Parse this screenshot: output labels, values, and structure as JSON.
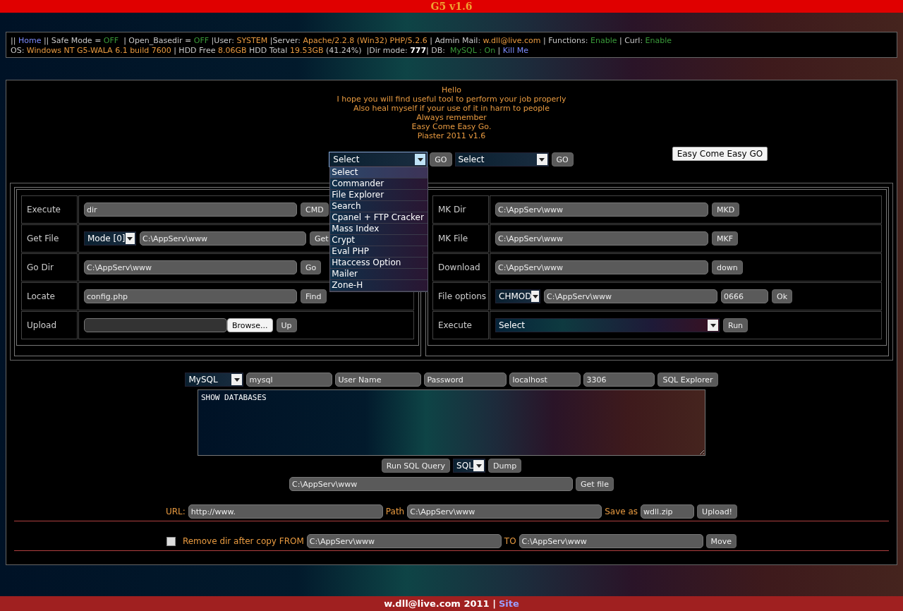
{
  "title": "G5 v1.6",
  "info_lines": [
    [
      {
        "kind": "plain",
        "text": "|| "
      },
      {
        "kind": "link",
        "text": "Home"
      },
      {
        "kind": "plain",
        "text": " || Safe Mode = "
      },
      {
        "kind": "on",
        "text": "OFF"
      },
      {
        "kind": "plain",
        "text": "  | Open_Basedir = "
      },
      {
        "kind": "on",
        "text": "OFF"
      },
      {
        "kind": "plain",
        "text": " |User: "
      },
      {
        "kind": "value",
        "text": "SYSTEM"
      },
      {
        "kind": "plain",
        "text": " |Server: "
      },
      {
        "kind": "value",
        "text": "Apache/2.2.8 (Win32) PHP/5.2.6"
      },
      {
        "kind": "plain",
        "text": " | Admin Mail: "
      },
      {
        "kind": "value",
        "text": "w.dll@live.com"
      },
      {
        "kind": "plain",
        "text": " | Functions: "
      },
      {
        "kind": "on",
        "text": "Enable"
      },
      {
        "kind": "plain",
        "text": " | Curl: "
      },
      {
        "kind": "on",
        "text": "Enable"
      }
    ],
    [
      {
        "kind": "plain",
        "text": "OS: "
      },
      {
        "kind": "value",
        "text": "Windows NT G5-WALA 6.1 build 7600"
      },
      {
        "kind": "plain",
        "text": " | HDD Free "
      },
      {
        "kind": "value",
        "text": "8.06GB"
      },
      {
        "kind": "plain",
        "text": " HDD Total "
      },
      {
        "kind": "value",
        "text": "19.53GB"
      },
      {
        "kind": "plain",
        "text": " (41.24%)  |Dir mode: "
      },
      {
        "kind": "bold",
        "text": "777"
      },
      {
        "kind": "plain",
        "text": "| DB:  "
      },
      {
        "kind": "on",
        "text": "MySQL : On"
      },
      {
        "kind": "plain",
        "text": " | "
      },
      {
        "kind": "link",
        "text": "Kill Me"
      }
    ]
  ],
  "greeting": [
    "Hello",
    "I hope you will find useful tool to perform your job properly",
    "Also heal myself if your use of it in harm to people",
    "Always remember",
    "Easy Come Easy Go.",
    "Piaster 2011 v1.6"
  ],
  "menu_selects": [
    {
      "value": "Select",
      "button": "GO",
      "expanded": true,
      "options": [
        {
          "label": "Select",
          "selected": true
        },
        {
          "label": "Commander",
          "selected": false
        },
        {
          "label": "File Explorer",
          "selected": false
        },
        {
          "label": "Search",
          "selected": false
        },
        {
          "label": "Cpanel + FTP Cracker",
          "selected": false
        },
        {
          "label": "Mass Index",
          "selected": false
        },
        {
          "label": "Crypt",
          "selected": false
        },
        {
          "label": "Eval PHP",
          "selected": false
        },
        {
          "label": "Htaccess Option",
          "selected": false
        },
        {
          "label": "Mailer",
          "selected": false
        },
        {
          "label": "Zone-H",
          "selected": false
        }
      ]
    },
    {
      "value": "Select",
      "button": "GO",
      "expanded": false
    }
  ],
  "motto_button": "Easy Come Easy GO",
  "left_tools": [
    {
      "kind": "input",
      "label": "Execute",
      "value": "dir",
      "button": "CMD"
    },
    {
      "kind": "mode",
      "label": "Get File",
      "select": "Mode [0]",
      "value": "C:\\AppServ\\www",
      "button": "Get"
    },
    {
      "kind": "input",
      "label": "Go Dir",
      "value": "C:\\AppServ\\www",
      "button": "Go"
    },
    {
      "kind": "input",
      "label": "Locate",
      "value": "config.php",
      "button": "Find"
    },
    {
      "kind": "upload",
      "label": "Upload",
      "browse": "Browse...",
      "button": "Up"
    }
  ],
  "right_tools": [
    {
      "kind": "input",
      "label": "MK Dir",
      "value": "C:\\AppServ\\www",
      "button": "MKD"
    },
    {
      "kind": "input",
      "label": "MK File",
      "value": "C:\\AppServ\\www",
      "button": "MKF"
    },
    {
      "kind": "input",
      "label": "Download",
      "value": "C:\\AppServ\\www",
      "button": "down"
    },
    {
      "kind": "chmod",
      "label": "File options",
      "select": "CHMOD",
      "value": "C:\\AppServ\\www",
      "mode": "0666",
      "button": "Ok"
    },
    {
      "kind": "select",
      "label": "Execute",
      "select": "Select",
      "button": "Run"
    }
  ],
  "sql": {
    "driver": "MySQL",
    "database": "mysql",
    "user": "User Name",
    "password": "Password",
    "host": "localhost",
    "port": "3306",
    "explorer_button": "SQL Explorer",
    "query": "SHOW DATABASES",
    "run_button": "Run SQL Query",
    "format": "SQL",
    "dump_button": "Dump"
  },
  "get_file": {
    "value": "C:\\AppServ\\www",
    "button": "Get file"
  },
  "url_upload": {
    "url_label": "URL:",
    "url": "http://www.",
    "path_label": "Path",
    "path": "C:\\AppServ\\www",
    "save_label": "Save as",
    "save": "wdll.zip",
    "button": "Upload!"
  },
  "move": {
    "checked": false,
    "from_label": "Remove dir after copy FROM",
    "from": "C:\\AppServ\\www",
    "to_label": "TO",
    "to": "C:\\AppServ\\www",
    "button": "Move"
  },
  "footer": {
    "text": "w.dll@live.com 2011 |",
    "link": "Site"
  }
}
